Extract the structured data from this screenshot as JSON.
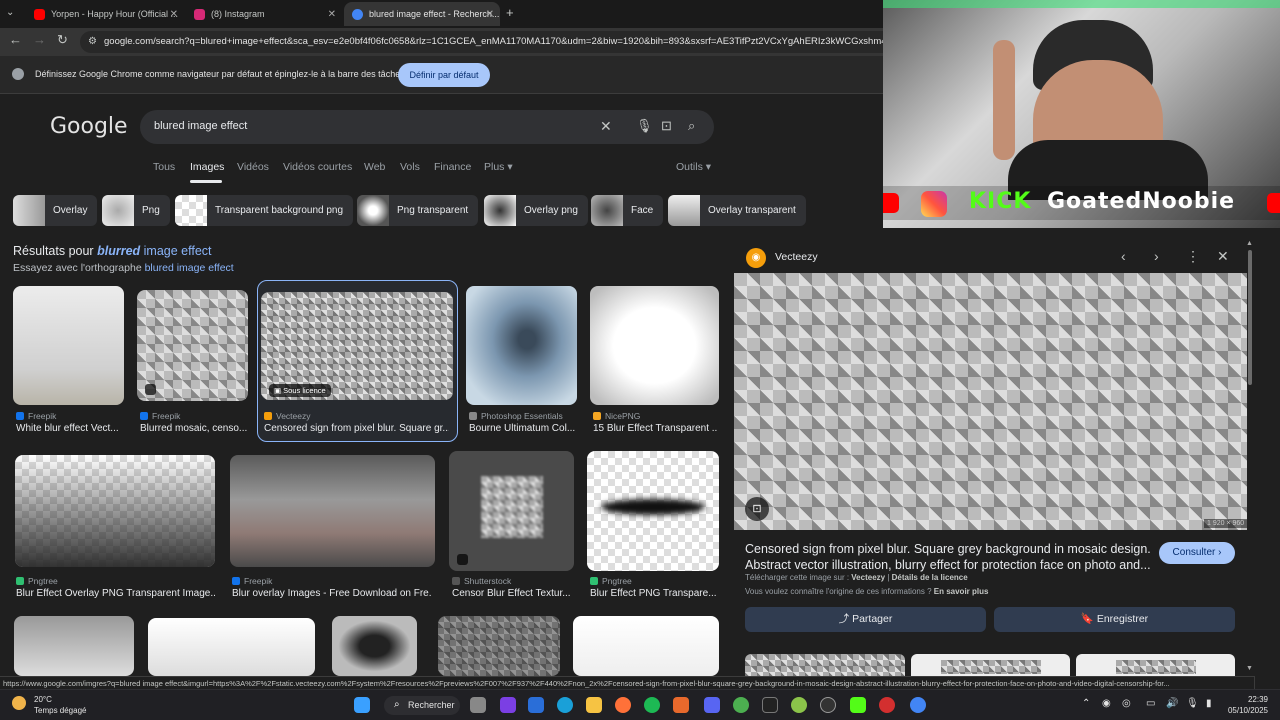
{
  "browser": {
    "tabs": [
      {
        "title": "Yorpen - Happy Hour (Official ...",
        "favicon_color": "#ff0000",
        "close": "✕"
      },
      {
        "title": "(8) Instagram",
        "favicon_color": "#d62976",
        "close": "✕"
      },
      {
        "title": "blured image effect - Recherch...",
        "favicon_color": "#4285f4",
        "close": "✕"
      }
    ],
    "new_tab": "+",
    "url": "google.com/search?q=blured+image+effect&sca_esv=e2e0bf4f06fc0658&rlz=1C1GCEA_enMA1170MA1170&udm=2&biw=1920&bih=893&sxsrf=AE3TifPzt2VCxYgAhERIz3kWCGxshm4RbQ..."
  },
  "infobar": {
    "text": "Définissez Google Chrome comme navigateur par défaut et épinglez-le à la barre des tâches",
    "button": "Définir par défaut"
  },
  "google": {
    "logo": "Google",
    "query": "blured image effect",
    "nav": [
      "Tous",
      "Images",
      "Vidéos",
      "Vidéos courtes",
      "Web",
      "Vols",
      "Finance",
      "Plus ▾"
    ],
    "tools": "Outils ▾",
    "chips": [
      "Overlay",
      "Png",
      "Transparent background png",
      "Png transparent",
      "Overlay png",
      "Face",
      "Overlay transparent"
    ],
    "results_prefix": "Résultats pour",
    "results_bold": "blurred",
    "results_rest": "image effect",
    "try_prefix": "Essayez avec l'orthographe",
    "try_link": "blured image effect"
  },
  "results": [
    {
      "source": "Freepik",
      "title": "White blur effect Vect...",
      "src_color": "#1273eb"
    },
    {
      "source": "Freepik",
      "title": "Blurred mosaic, censo...",
      "src_color": "#1273eb"
    },
    {
      "source": "Vecteezy",
      "title": "Censored sign from pixel blur. Square gr...",
      "src_color": "#f59e0b",
      "badge": "Sous licence"
    },
    {
      "source": "Photoshop Essentials",
      "title": "Bourne Ultimatum Col...",
      "src_color": "#888888"
    },
    {
      "source": "NicePNG",
      "title": "15 Blur Effect Transparent ...",
      "src_color": "#f5a623"
    },
    {
      "source": "Pngtree",
      "title": "Blur Effect Overlay PNG Transparent Image...",
      "src_color": "#2fbf71"
    },
    {
      "source": "Freepik",
      "title": "Blur overlay Images - Free Download on Fre...",
      "src_color": "#1273eb"
    },
    {
      "source": "Shutterstock",
      "title": "Censor Blur Effect Textur...",
      "src_color": "#555555"
    },
    {
      "source": "Pngtree",
      "title": "Blur Effect PNG Transpare...",
      "src_color": "#2fbf71"
    }
  ],
  "panel": {
    "source": "Vecteezy",
    "dims": "1 920 × 960",
    "title": "Censored sign from pixel blur. Square grey background in mosaic design. Abstract vector illustration, blurry effect for protection face on photo and...",
    "consult": "Consulter ›",
    "license_prefix": "Télécharger cette image sur :",
    "license_site": "Vecteezy",
    "license_sep": "|",
    "license_link": "Détails de la licence",
    "origin_prefix": "Vous voulez connaître l'origine de ces informations ?",
    "origin_link": "En savoir plus",
    "share": "Partager",
    "save": "Enregistrer"
  },
  "webcam": {
    "banner_kick": "KICK",
    "banner_name": "GoatedNoobie"
  },
  "status_url": "https://www.google.com/imgres?q=blured image effect&imgurl=https%3A%2F%2Fstatic.vecteezy.com%2Fsystem%2Fresources%2Fpreviews%2F007%2F937%2F440%2Fnon_2x%2Fcensored-sign-from-pixel-blur-square-grey-background-in-mosaic-design-abstract-illustration-blurry-effect-for-protection-face-on-photo-and-video-digital-censorship-for...",
  "taskbar": {
    "temp": "20°C",
    "weather": "Temps dégagé",
    "search": "Rechercher",
    "time": "22:39",
    "date": "05/10/2025"
  }
}
